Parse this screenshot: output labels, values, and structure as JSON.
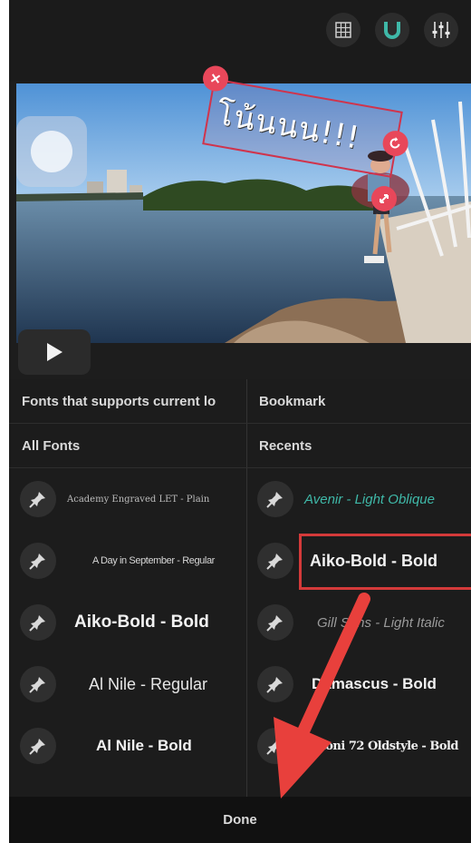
{
  "toolbar": {
    "icons": [
      "grid-icon",
      "magnet-icon",
      "sliders-icon"
    ]
  },
  "video": {
    "sticker_text": "โน้นนน!!!"
  },
  "fonts": {
    "left_tab": "Fonts that supports current lo",
    "right_tab": "Bookmark",
    "left_header": "All Fonts",
    "right_header": "Recents",
    "all_fonts": [
      "Academy Engraved LET - Plain",
      "A Day in September - Regular",
      "Aiko-Bold  -  Bold",
      "Al Nile - Regular",
      "Al Nile - Bold"
    ],
    "recents": [
      "Avenir - Light Oblique",
      "Aiko-Bold  -  Bold",
      "Gill Sans - Light Italic",
      "Damascus - Bold",
      "Bodoni 72 Oldstyle - Bold"
    ]
  },
  "footer": {
    "done_label": "Done"
  },
  "colors": {
    "highlight": "#d43a3a",
    "accent_teal": "#3fb8a8",
    "arrow": "#e8403c"
  }
}
